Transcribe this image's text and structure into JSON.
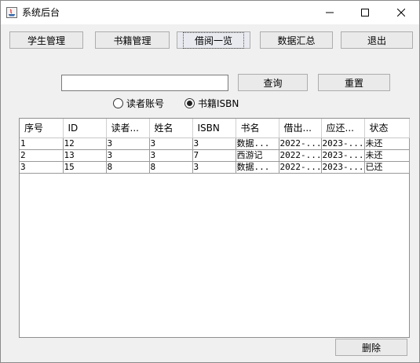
{
  "window": {
    "title": "系统后台"
  },
  "toolbar": {
    "buttons": [
      {
        "label": "学生管理"
      },
      {
        "label": "书籍管理"
      },
      {
        "label": "借阅一览"
      },
      {
        "label": "数据汇总"
      },
      {
        "label": "退出"
      }
    ]
  },
  "search": {
    "value": "",
    "query_label": "查询",
    "reset_label": "重置",
    "options": [
      {
        "label": "读者账号",
        "selected": false
      },
      {
        "label": "书籍ISBN",
        "selected": true
      }
    ]
  },
  "table": {
    "columns": [
      "序号",
      "ID",
      "读者...",
      "姓名",
      "ISBN",
      "书名",
      "借出...",
      "应还...",
      "状态"
    ],
    "rows": [
      [
        "1",
        "12",
        "3",
        "3",
        "3",
        "数据...",
        "2022-...",
        "2023-...",
        "未还"
      ],
      [
        "2",
        "13",
        "3",
        "3",
        "7",
        "西游记",
        "2022-...",
        "2023-...",
        "未还"
      ],
      [
        "3",
        "15",
        "8",
        "8",
        "3",
        "数据...",
        "2022-...",
        "2023-...",
        "已还"
      ]
    ]
  },
  "actions": {
    "delete_label": "删除"
  }
}
